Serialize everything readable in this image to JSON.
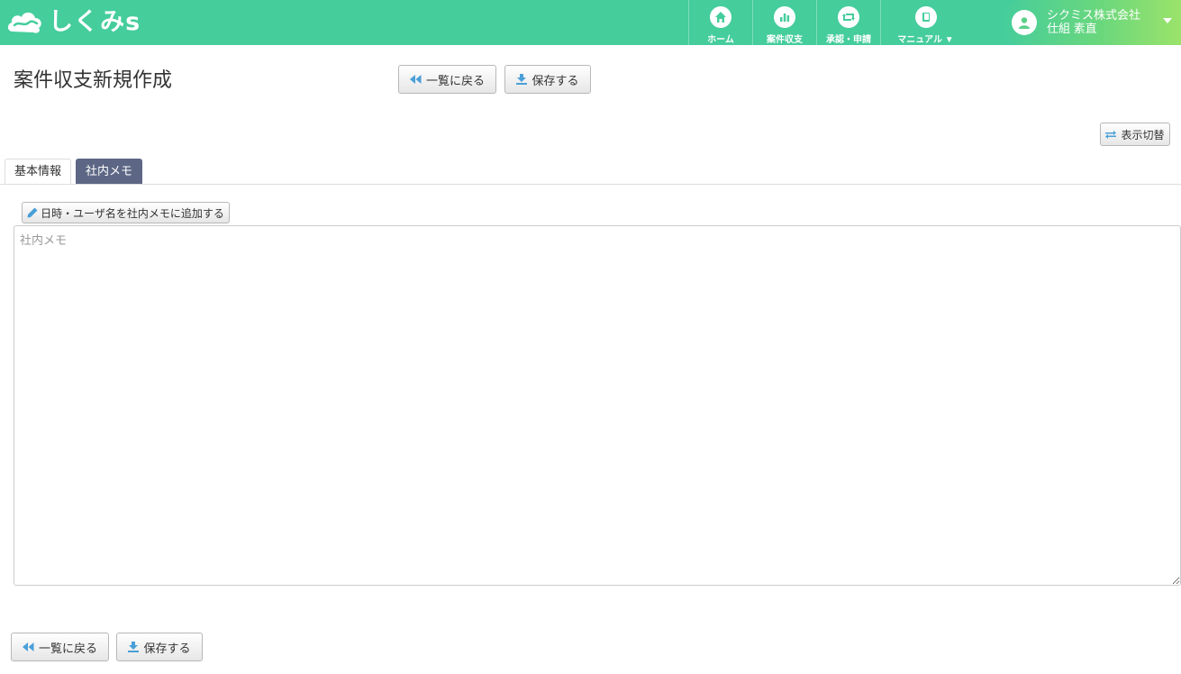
{
  "header": {
    "logo_text": "しくみs",
    "nav": [
      {
        "label": "ホーム",
        "icon": "home-icon"
      },
      {
        "label": "案件収支",
        "icon": "bar-chart-icon"
      },
      {
        "label": "承認・申請",
        "icon": "retweet-icon"
      },
      {
        "label": "マニュアル ▼",
        "icon": "book-icon"
      }
    ],
    "user": {
      "company": "シクミス株式会社",
      "name": "仕組 素直"
    }
  },
  "page": {
    "title": "案件収支新規作成",
    "back_label": "一覧に戻る",
    "save_label": "保存する",
    "toggle_label": "表示切替"
  },
  "tabs": [
    {
      "label": "基本情報",
      "active": false
    },
    {
      "label": "社内メモ",
      "active": true
    }
  ],
  "memo": {
    "add_stamp_label": "日時・ユーザ名を社内メモに追加する",
    "placeholder": "社内メモ",
    "value": ""
  },
  "colors": {
    "nav_bg": "#45cd9c",
    "active_tab": "#5d6785",
    "icon_blue": "#4a9fd8"
  }
}
